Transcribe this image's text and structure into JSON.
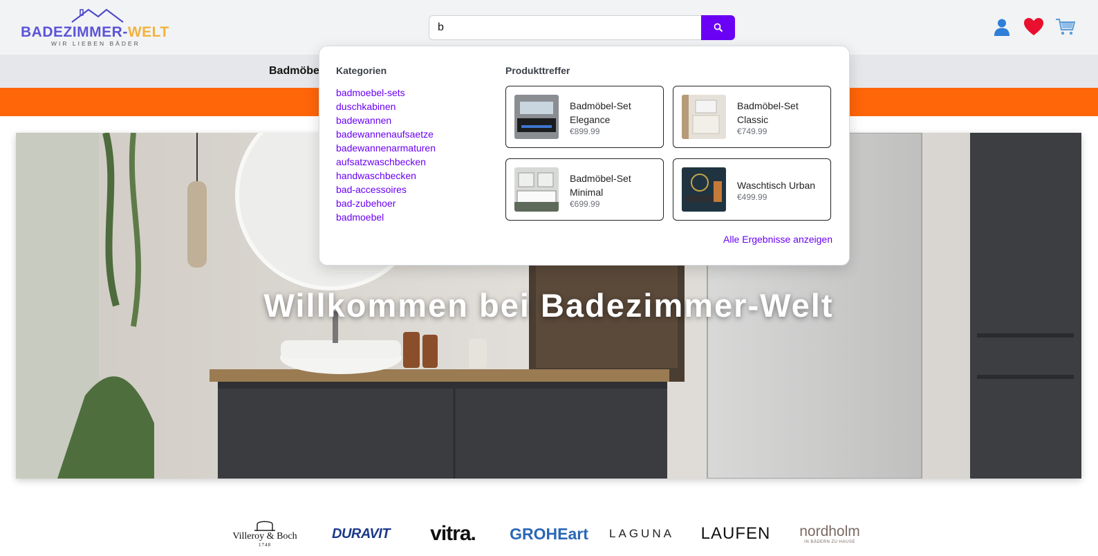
{
  "header": {
    "logo": {
      "brand_part1": "BADEZIMMER-",
      "brand_part2": "WELT",
      "tagline": "WIR LIEBEN BÄDER"
    },
    "search": {
      "value": "b",
      "placeholder": "",
      "button_icon": "search-icon"
    },
    "icons": [
      "user-icon",
      "heart-icon",
      "cart-icon"
    ]
  },
  "nav": {
    "items": [
      {
        "label": "Badmöbel"
      }
    ]
  },
  "hero": {
    "title": "Willkommen bei Badezimmer-Welt"
  },
  "search_dropdown": {
    "categories_heading": "Kategorien",
    "categories": [
      "badmoebel-sets",
      "duschkabinen",
      "badewannen",
      "badewannenaufsaetze",
      "badewannenarmaturen",
      "aufsatzwaschbecken",
      "handwaschbecken",
      "bad-accessoires",
      "bad-zubehoer",
      "badmoebel"
    ],
    "products_heading": "Produkttreffer",
    "products": [
      {
        "name": "Badmöbel-Set Elegance",
        "price": "€899.99"
      },
      {
        "name": "Badmöbel-Set Classic",
        "price": "€749.99"
      },
      {
        "name": "Badmöbel-Set Minimal",
        "price": "€699.99"
      },
      {
        "name": "Waschtisch Urban",
        "price": "€499.99"
      }
    ],
    "all_results_label": "Alle Ergebnisse anzeigen"
  },
  "brands": [
    {
      "name": "Villeroy & Boch",
      "sub": "1748"
    },
    {
      "name": "DURAVIT"
    },
    {
      "name": "vitra."
    },
    {
      "name": "GROHEart"
    },
    {
      "name": "LAGUNA"
    },
    {
      "name": "LAUFEN"
    },
    {
      "name": "nordholm",
      "sub": "IN BÄDERN ZU HAUSE"
    }
  ],
  "colors": {
    "accent": "#6a00f4",
    "promo": "#ff6509",
    "header_bg": "#f2f3f5",
    "nav_bg": "#e6e7ea"
  }
}
